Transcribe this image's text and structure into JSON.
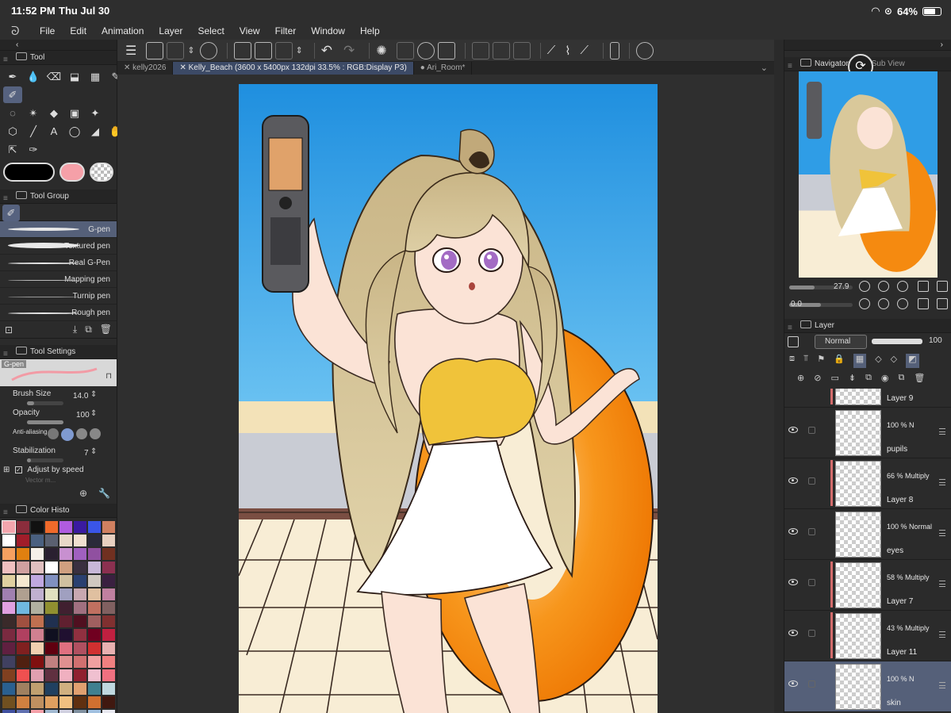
{
  "status": {
    "time": "11:52 PM",
    "date": "Thu Jul 30",
    "battery": "64%",
    "battery_level": 0.64
  },
  "menu": [
    "File",
    "Edit",
    "Animation",
    "Layer",
    "Select",
    "View",
    "Filter",
    "Window",
    "Help"
  ],
  "tabs": [
    {
      "label": "kelly2026",
      "active": false
    },
    {
      "label": "Kelly_Beach (3600 x 5400px 132dpi 33.5% : RGB:Display P3)",
      "active": true
    },
    {
      "label": "Ari_Room*",
      "active": false
    }
  ],
  "tool_panel": {
    "title": "Tool"
  },
  "tool_group": {
    "title": "Tool Group",
    "brushes": [
      {
        "label": "G-pen",
        "selected": true
      },
      {
        "label": "Textured pen",
        "selected": false
      },
      {
        "label": "Real G-Pen",
        "selected": false
      },
      {
        "label": "Mapping pen",
        "selected": false
      },
      {
        "label": "Turnip pen",
        "selected": false
      },
      {
        "label": "Rough pen",
        "selected": false
      }
    ]
  },
  "tool_settings": {
    "title": "Tool Settings",
    "brush_name": "G-pen",
    "brush_size_label": "Brush Size",
    "brush_size": "14.0",
    "opacity_label": "Opacity",
    "opacity": "100",
    "antialias_label": "Anti-aliasing",
    "stabilization_label": "Stabilization",
    "stabilization": "7",
    "adjust_label": "Adjust by speed",
    "truncated_label": "Vector m..."
  },
  "color_history": {
    "title": "Color Histo",
    "main_color": "#000000",
    "sub_color": "#f5a0a8",
    "colors": [
      "#f3a6ae",
      "#8b2d3c",
      "#111111",
      "#f06a2a",
      "#b05ce0",
      "#3a1aa0",
      "#3a55e8",
      "#d08060",
      "#ffffff",
      "#a11d2a",
      "#4a6080",
      "#5a6070",
      "#e8d8c8",
      "#f0e0d0",
      "#2a2a3a",
      "#e8d0c0",
      "#f5a060",
      "#e08010",
      "#f5f0e8",
      "#2a2030",
      "#c890d0",
      "#a060c0",
      "#9050a0",
      "#703020",
      "#f0c0c0",
      "#d0a0a0",
      "#e0c0c0",
      "#ffffff",
      "#d0a080",
      "#3a3040",
      "#c8b8d8",
      "#8b3050",
      "#e0d0a0",
      "#f5e8d0",
      "#c0a8e0",
      "#8090c0",
      "#d0c0a0",
      "#2a4070",
      "#d0c8c0",
      "#3a2040",
      "#a080b0",
      "#b0a090",
      "#c0b0d0",
      "#e0e0c0",
      "#a0a0c0",
      "#c8a8b0",
      "#e0c0a0",
      "#c080a0",
      "#e0a0e0",
      "#70b8e0",
      "#b0b0a0",
      "#909030",
      "#402030",
      "#a07080",
      "#c07060",
      "#806060",
      "#3a2a2a",
      "#a05040",
      "#c07050",
      "#203050",
      "#602030",
      "#501020",
      "#a06060",
      "#803030",
      "#7a2a40",
      "#b04060",
      "#d08090",
      "#101020",
      "#201030",
      "#903040",
      "#700020",
      "#c02040",
      "#602040",
      "#802020",
      "#f0d0b0",
      "#600010",
      "#e07080",
      "#b05060",
      "#d03030",
      "#e8b0b0",
      "#404060",
      "#502010",
      "#801010",
      "#c08080",
      "#e09090",
      "#d07070",
      "#f0a0a0",
      "#f08080",
      "#804020",
      "#f05050",
      "#e0a0b0",
      "#603040",
      "#f0b0c0",
      "#902030",
      "#f0c0d0",
      "#f07080",
      "#2a6090",
      "#a08060",
      "#c0a070",
      "#204060",
      "#d0b080",
      "#e0a070",
      "#408090",
      "#c0d8e0",
      "#705020",
      "#d08040",
      "#c09060",
      "#e0a060",
      "#f0c080",
      "#603010",
      "#d07030",
      "#401810",
      "#4050a0",
      "#6070b0",
      "#f5a0a8",
      "#a0b8d0",
      "#d0d0e0",
      "#8090a0",
      "#a0c0e0",
      "#e8e8f0"
    ]
  },
  "navigator": {
    "title": "Navigator",
    "sub_title": "Sub View",
    "zoom": "27.9",
    "rotation": "0.0"
  },
  "layer_panel": {
    "title": "Layer",
    "blend_mode": "Normal",
    "opacity": "100",
    "layers": [
      {
        "name": "Layer 9",
        "opacity": "",
        "mode": "",
        "visible": false,
        "clip": true,
        "selected": false
      },
      {
        "name": "pupils",
        "opacity": "100 %",
        "mode": "N",
        "visible": true,
        "clip": false,
        "selected": false
      },
      {
        "name": "Layer 8",
        "opacity": "66 %",
        "mode": "Multiply",
        "visible": true,
        "clip": true,
        "selected": false
      },
      {
        "name": "eyes",
        "opacity": "100 %",
        "mode": "Normal",
        "visible": true,
        "clip": false,
        "selected": false
      },
      {
        "name": "Layer 7",
        "opacity": "58 %",
        "mode": "Multiply",
        "visible": true,
        "clip": true,
        "selected": false
      },
      {
        "name": "Layer 11",
        "opacity": "43 %",
        "mode": "Multiply",
        "visible": true,
        "clip": true,
        "selected": false
      },
      {
        "name": "skin",
        "opacity": "100 %",
        "mode": "N",
        "visible": true,
        "clip": false,
        "selected": true
      }
    ]
  },
  "artwork_colors": {
    "sky": "#2f9de6",
    "hair": "#d9c89a",
    "top": "#f0c33a",
    "dress": "#ffffff",
    "ring": "#f58a10",
    "deck": "#f7ecd3",
    "skin": "#fbe3d6",
    "eye": "#a36cc4"
  }
}
